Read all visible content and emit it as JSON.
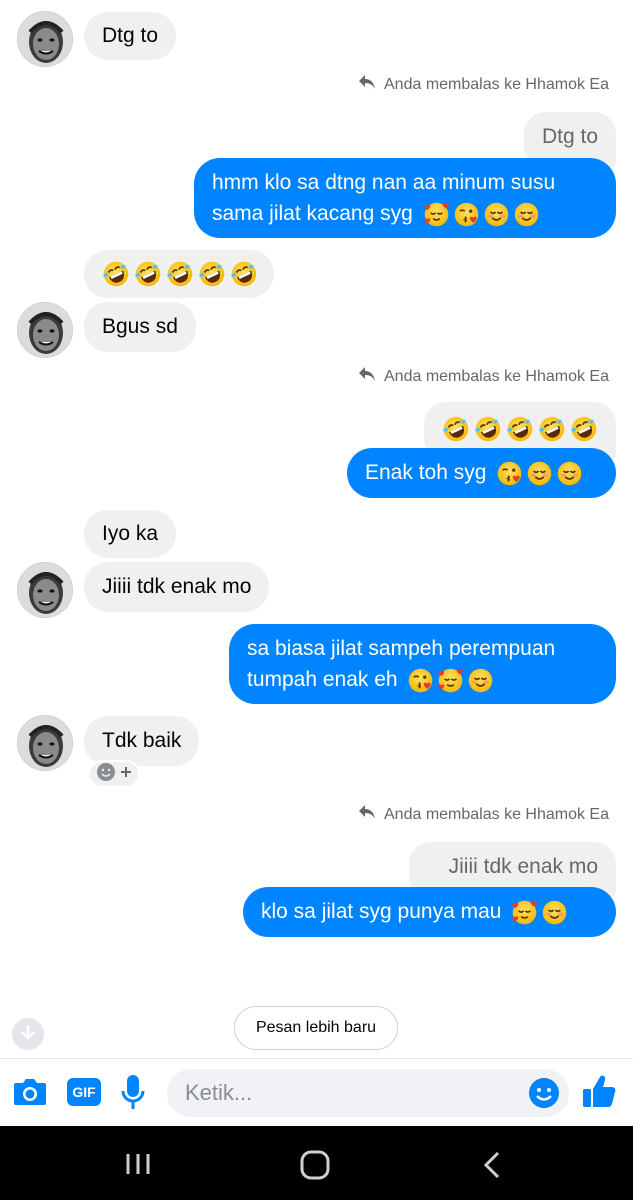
{
  "messages": {
    "m1": "Dtg to",
    "reply_note_1": "Anda membalas ke Hhamok Ea",
    "quote_1": "Dtg to",
    "out_1_line1": "hmm klo sa dtng nan aa minum susu",
    "out_1_line2": "sama jilat kacang syg",
    "m3": "Bgus sd",
    "reply_note_2": "Anda membalas ke Hhamok Ea",
    "out_2": "Enak toh syg",
    "m4": "Iyo ka",
    "m5": "Jiiii tdk enak mo",
    "out_3_line1": "sa biasa jilat sampeh perempuan",
    "out_3_line2": "tumpah enak eh",
    "m6": "Tdk baik",
    "reply_note_3": "Anda membalas ke Hhamok Ea",
    "quote_2": "Jiiii tdk enak mo",
    "out_4": "klo sa jilat syg punya mau"
  },
  "newer_button": "Pesan lebih baru",
  "composer": {
    "placeholder": "Ketik...",
    "gif_label": "GIF"
  },
  "colors": {
    "outgoing": "#0084ff",
    "incoming": "#f0f0f0",
    "accent": "#0084ff"
  },
  "icons": [
    "camera-icon",
    "gif-icon",
    "microphone-icon",
    "emoji-icon",
    "like-icon",
    "reply-icon",
    "arrow-down-icon",
    "recents-icon",
    "home-icon",
    "back-icon"
  ]
}
